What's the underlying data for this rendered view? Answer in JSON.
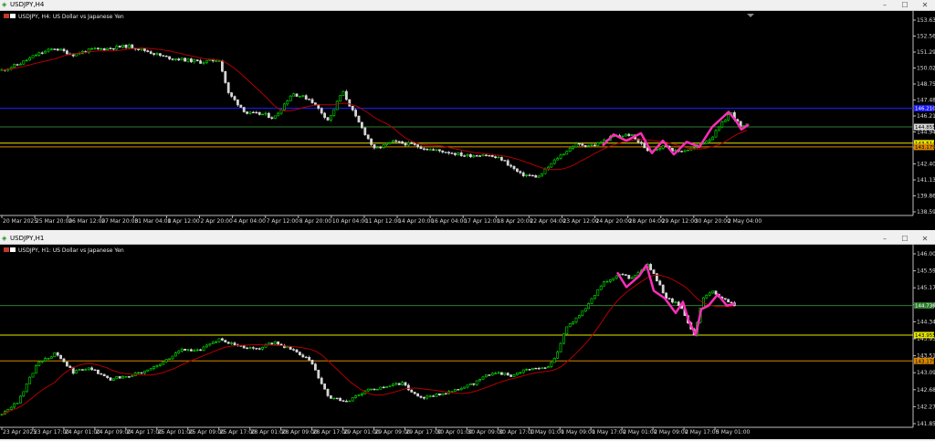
{
  "colors": {
    "bull": "#00e600",
    "bear": "#d7d7d7",
    "ma": "#b30000",
    "zigzag": "#ff2db8",
    "blue_line": "#1a1aff",
    "green_line": "#2e7d2e",
    "yellow_line": "#e6e600",
    "orange_line": "#d98800"
  },
  "windows": [
    {
      "title": "USDJPY,H4",
      "symbol_text": "USDJPY, H4: US Dollar vs Japanese Yen",
      "price_axis": {
        "min": 138.0,
        "max": 153.8
      },
      "price_labels": [
        "153.630",
        "152.560",
        "151.290",
        "150.020",
        "148.750",
        "147.480",
        "146.210",
        "144.940",
        "143.670",
        "142.400",
        "141.130",
        "139.860",
        "138.590"
      ],
      "time_labels": [
        "20 Mar 2025",
        "25 Mar 20:00",
        "26 Mar 12:00",
        "27 Mar 20:00",
        "31 Mar 04:00",
        "1 Apr 12:00",
        "2 Apr 20:00",
        "4 Apr 04:00",
        "7 Apr 12:00",
        "8 Apr 20:00",
        "10 Apr 04:00",
        "11 Apr 12:00",
        "14 Apr 20:00",
        "16 Apr 04:00",
        "17 Apr 12:00",
        "18 Apr 20:00",
        "22 Apr 04:00",
        "23 Apr 12:00",
        "24 Apr 20:00",
        "28 Apr 04:00",
        "29 Apr 12:00",
        "30 Apr 20:00",
        "2 May 04:00"
      ],
      "lines": [
        {
          "name": "blue",
          "price": 146.3,
          "color": "blue_line"
        },
        {
          "name": "green",
          "price": 144.8,
          "color": "green_line"
        },
        {
          "name": "yellow",
          "price": 143.5,
          "color": "yellow_line"
        },
        {
          "name": "orange",
          "price": 143.2,
          "color": "orange_line"
        }
      ],
      "price_tags": [
        {
          "text": "146.210",
          "price": 146.3,
          "bg": "#1a1aff",
          "fg": "#ffffff"
        },
        {
          "text": "144.855",
          "price": 144.8,
          "bg": "#d7d7d7",
          "fg": "#000000"
        },
        {
          "text": "143.514",
          "price": 143.5,
          "bg": "#e6e600",
          "fg": "#000000"
        },
        {
          "text": "143.179",
          "price": 143.2,
          "bg": "#d98800",
          "fg": "#000000"
        }
      ],
      "anchors": [
        [
          0,
          149.3
        ],
        [
          20,
          149.8
        ],
        [
          40,
          150.6
        ],
        [
          60,
          151.1
        ],
        [
          80,
          150.6
        ],
        [
          100,
          151.0
        ],
        [
          120,
          151.1
        ],
        [
          140,
          151.3
        ],
        [
          160,
          150.9
        ],
        [
          180,
          150.4
        ],
        [
          200,
          150.2
        ],
        [
          220,
          150.0
        ],
        [
          240,
          150.2
        ],
        [
          250,
          147.5
        ],
        [
          270,
          145.9
        ],
        [
          290,
          145.8
        ],
        [
          300,
          145.5
        ],
        [
          320,
          147.5
        ],
        [
          340,
          147.0
        ],
        [
          360,
          145.3
        ],
        [
          375,
          147.7
        ],
        [
          390,
          145.5
        ],
        [
          410,
          143.0
        ],
        [
          430,
          143.6
        ],
        [
          450,
          143.4
        ],
        [
          470,
          143.0
        ],
        [
          490,
          142.8
        ],
        [
          510,
          142.5
        ],
        [
          530,
          142.6
        ],
        [
          550,
          142.2
        ],
        [
          570,
          141.0
        ],
        [
          590,
          140.8
        ],
        [
          610,
          142.3
        ],
        [
          630,
          143.4
        ],
        [
          650,
          143.3
        ],
        [
          670,
          144.0
        ],
        [
          690,
          144.2
        ],
        [
          710,
          142.9
        ],
        [
          730,
          143.3
        ],
        [
          740,
          142.8
        ],
        [
          760,
          143.1
        ],
        [
          780,
          144.0
        ],
        [
          800,
          146.0
        ],
        [
          812,
          144.7
        ],
        [
          820,
          145.0
        ]
      ],
      "zigzag": [
        [
          660,
          143.3
        ],
        [
          672,
          144.2
        ],
        [
          686,
          143.7
        ],
        [
          702,
          144.3
        ],
        [
          714,
          142.7
        ],
        [
          726,
          143.7
        ],
        [
          738,
          142.6
        ],
        [
          752,
          143.6
        ],
        [
          766,
          143.2
        ],
        [
          780,
          144.8
        ],
        [
          798,
          146.0
        ],
        [
          806,
          145.3
        ],
        [
          812,
          144.6
        ],
        [
          820,
          145.0
        ]
      ]
    },
    {
      "title": "USDJPY,H1",
      "symbol_text": "USDJPY, H1: US Dollar vs Japanese Yen",
      "price_axis": {
        "min": 141.5,
        "max": 146.25
      },
      "price_labels": [
        "146.005",
        "145.590",
        "145.175",
        "144.760",
        "144.340",
        "143.930",
        "143.515",
        "143.095",
        "142.685",
        "142.270",
        "141.855"
      ],
      "time_labels": [
        "23 Apr 2025",
        "23 Apr 17:00",
        "24 Apr 01:00",
        "24 Apr 09:00",
        "24 Apr 17:00",
        "25 Apr 01:00",
        "25 Apr 09:00",
        "25 Apr 17:00",
        "28 Apr 01:00",
        "28 Apr 09:00",
        "28 Apr 17:00",
        "29 Apr 01:00",
        "29 Apr 09:00",
        "29 Apr 17:00",
        "30 Apr 01:00",
        "30 Apr 09:00",
        "30 Apr 17:00",
        "1 May 01:00",
        "1 May 09:00",
        "1 May 17:00",
        "2 May 01:00",
        "2 May 09:00",
        "2 May 17:00",
        "5 May 01:00"
      ],
      "lines": [
        {
          "name": "green",
          "price": 144.7,
          "color": "green_line"
        },
        {
          "name": "yellow",
          "price": 143.9,
          "color": "yellow_line"
        },
        {
          "name": "orange",
          "price": 143.2,
          "color": "orange_line"
        }
      ],
      "price_tags": [
        {
          "text": "144.736",
          "price": 144.7,
          "bg": "#2e7d2e",
          "fg": "#ffffff"
        },
        {
          "text": "143.955",
          "price": 143.9,
          "bg": "#e6e600",
          "fg": "#000000"
        },
        {
          "text": "143.179",
          "price": 143.2,
          "bg": "#d98800",
          "fg": "#000000"
        }
      ],
      "anchors": [
        [
          0,
          141.7
        ],
        [
          20,
          142.1
        ],
        [
          40,
          143.1
        ],
        [
          60,
          143.4
        ],
        [
          80,
          142.9
        ],
        [
          100,
          143.0
        ],
        [
          120,
          142.7
        ],
        [
          140,
          142.8
        ],
        [
          160,
          142.9
        ],
        [
          180,
          143.2
        ],
        [
          200,
          143.5
        ],
        [
          220,
          143.5
        ],
        [
          240,
          143.8
        ],
        [
          260,
          143.6
        ],
        [
          280,
          143.5
        ],
        [
          300,
          143.7
        ],
        [
          320,
          143.5
        ],
        [
          340,
          143.2
        ],
        [
          360,
          142.2
        ],
        [
          380,
          142.1
        ],
        [
          400,
          142.4
        ],
        [
          420,
          142.5
        ],
        [
          440,
          142.6
        ],
        [
          460,
          142.2
        ],
        [
          480,
          142.3
        ],
        [
          500,
          142.4
        ],
        [
          520,
          142.6
        ],
        [
          540,
          142.9
        ],
        [
          560,
          142.8
        ],
        [
          580,
          143.0
        ],
        [
          600,
          143.0
        ],
        [
          610,
          143.4
        ],
        [
          620,
          144.1
        ],
        [
          640,
          144.6
        ],
        [
          660,
          145.3
        ],
        [
          680,
          145.6
        ],
        [
          690,
          145.4
        ],
        [
          700,
          145.6
        ],
        [
          710,
          145.8
        ],
        [
          730,
          144.9
        ],
        [
          745,
          144.7
        ],
        [
          760,
          143.9
        ],
        [
          770,
          144.9
        ],
        [
          780,
          145.1
        ],
        [
          790,
          144.9
        ],
        [
          805,
          144.7
        ]
      ],
      "zigzag": [
        [
          676,
          145.6
        ],
        [
          686,
          145.2
        ],
        [
          700,
          145.5
        ],
        [
          708,
          145.8
        ],
        [
          716,
          145.1
        ],
        [
          728,
          144.9
        ],
        [
          740,
          144.5
        ],
        [
          748,
          144.8
        ],
        [
          754,
          144.3
        ],
        [
          762,
          143.9
        ],
        [
          768,
          144.6
        ],
        [
          776,
          144.7
        ],
        [
          786,
          145.0
        ],
        [
          796,
          144.7
        ],
        [
          805,
          144.75
        ]
      ]
    }
  ]
}
